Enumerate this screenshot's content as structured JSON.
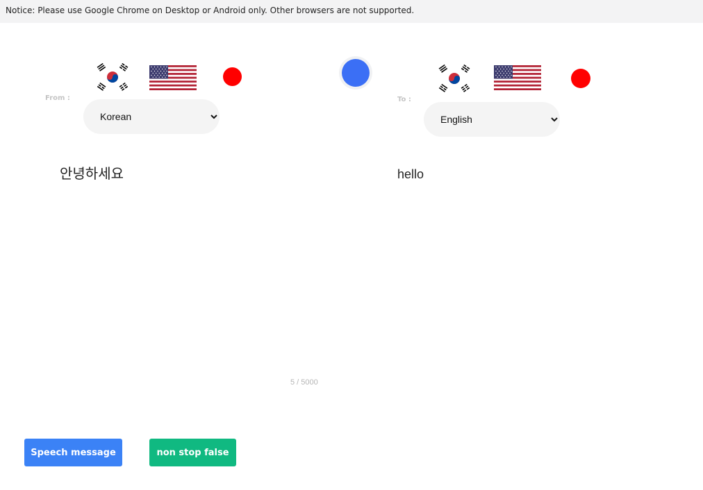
{
  "notice": {
    "text": "Notice: Please use Google Chrome on Desktop or Android only. Other browsers are not supported."
  },
  "from": {
    "label": "From :",
    "selected_language": "Korean",
    "text": "안녕하세요"
  },
  "to": {
    "label": "To :",
    "selected_language": "English",
    "text": "hello"
  },
  "counter": "5 / 5000",
  "buttons": {
    "speech": "Speech message",
    "nonstop": "non stop false"
  },
  "colors": {
    "notice_bg": "#f3f3f4",
    "record_dot": "#ff0000",
    "swap_button": "#3b6ff5",
    "speech_button": "#3b82f6",
    "nonstop_button": "#10b981"
  },
  "icons": {
    "korean_flag": "korea-flag-icon",
    "us_flag": "us-flag-icon",
    "record": "record-dot-icon",
    "swap": "swap-circle-icon"
  }
}
